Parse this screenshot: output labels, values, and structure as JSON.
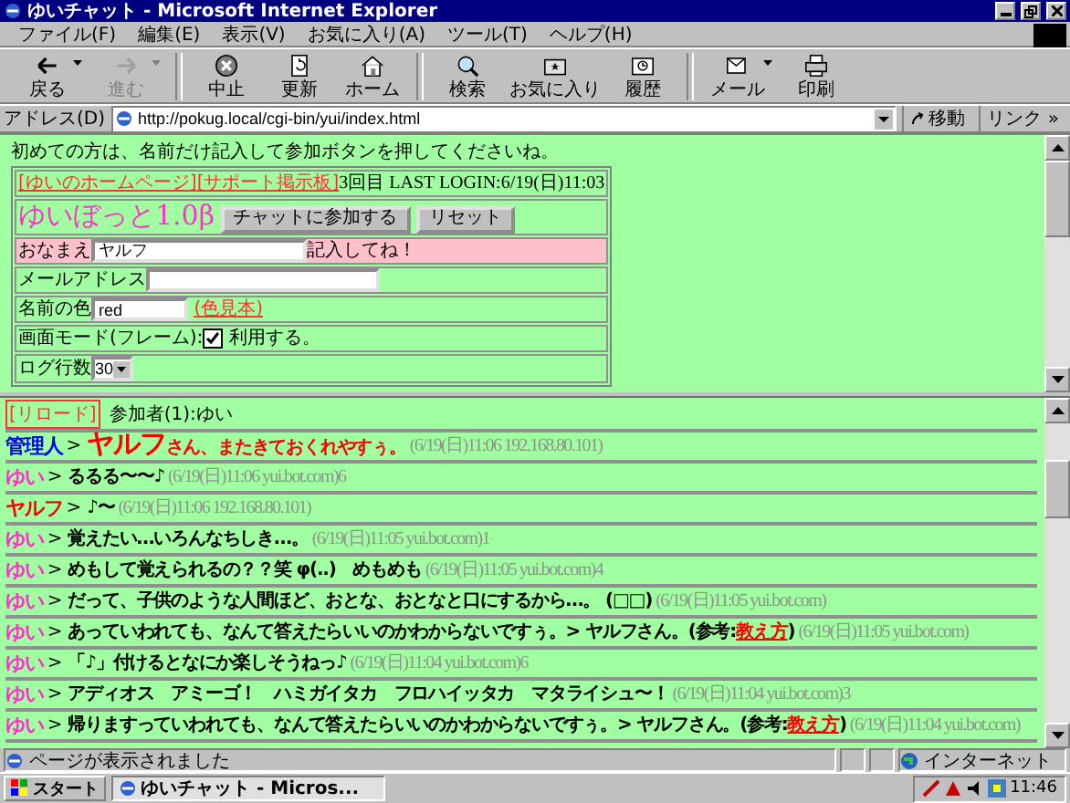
{
  "window": {
    "title": "ゆいチャット - Microsoft Internet Explorer"
  },
  "menu": [
    "ファイル(F)",
    "編集(E)",
    "表示(V)",
    "お気に入り(A)",
    "ツール(T)",
    "ヘルプ(H)"
  ],
  "toolbar": [
    {
      "label": "戻る",
      "kind": "back",
      "disabled": false,
      "dropdown": true
    },
    {
      "label": "進む",
      "kind": "forward",
      "disabled": true,
      "dropdown": true
    },
    {
      "label": "中止",
      "kind": "stop",
      "disabled": false,
      "dropdown": false
    },
    {
      "label": "更新",
      "kind": "refresh",
      "disabled": false,
      "dropdown": false
    },
    {
      "label": "ホーム",
      "kind": "home",
      "disabled": false,
      "dropdown": false
    },
    {
      "label": "検索",
      "kind": "search",
      "disabled": false,
      "dropdown": false
    },
    {
      "label": "お気に入り",
      "kind": "favorites",
      "disabled": false,
      "dropdown": false
    },
    {
      "label": "履歴",
      "kind": "history",
      "disabled": false,
      "dropdown": false
    },
    {
      "label": "メール",
      "kind": "mail",
      "disabled": false,
      "dropdown": true
    },
    {
      "label": "印刷",
      "kind": "print",
      "disabled": false,
      "dropdown": false
    }
  ],
  "address": {
    "label": "アドレス(D)",
    "value": "http://pokug.local/cgi-bin/yui/index.html",
    "go": "移動",
    "links": "リンク »"
  },
  "login_frame": {
    "intro": "初めての方は、名前だけ記入して参加ボタンを押してくださいね。",
    "links": [
      "[ゆいのホームページ]",
      "[サポート掲示板]"
    ],
    "login_info": "3回目 LAST LOGIN:6/19(日)11:03",
    "logo": "ゆいぼっと1.0β",
    "buttons": [
      "チャットに参加する",
      "リセット"
    ],
    "name": {
      "label": "おなまえ",
      "value": "ヤルフ",
      "hint": "記入してね！"
    },
    "email": {
      "label": "メールアドレス"
    },
    "color": {
      "label": "名前の色",
      "value": "red",
      "link": "(色見本)"
    },
    "frame_mode": {
      "label": "画面モード(フレーム):",
      "checked": true,
      "option": "利用する。"
    },
    "log_lines": {
      "label": "ログ行数",
      "value": "30"
    }
  },
  "chat_frame": {
    "reload": "[リロード]",
    "participants": "参加者(1):ゆい",
    "messages": [
      {
        "speaker": "管理人",
        "kind": "admin",
        "arrow": ">",
        "parts": [
          {
            "kind": "emph",
            "text": "ヤルフ"
          },
          {
            "kind": "plain",
            "text": "さん、またきておくれやすぅ。"
          }
        ],
        "meta": "(6/19(日)11:06 192.168.80.101)"
      },
      {
        "speaker": "ゆい",
        "kind": "bot",
        "arrow": ">",
        "parts": [
          {
            "kind": "plain",
            "text": "るるる〜〜♪"
          }
        ],
        "meta": "(6/19(日)11:06 yui.bot.com)6"
      },
      {
        "speaker": "ヤルフ",
        "kind": "user",
        "arrow": ">",
        "parts": [
          {
            "kind": "plain",
            "text": "♪〜"
          }
        ],
        "meta": "(6/19(日)11:06 192.168.80.101)"
      },
      {
        "speaker": "ゆい",
        "kind": "bot",
        "arrow": ">",
        "parts": [
          {
            "kind": "plain",
            "text": "覚えたい…いろんなちしき…。"
          }
        ],
        "meta": "(6/19(日)11:05 yui.bot.com)1"
      },
      {
        "speaker": "ゆい",
        "kind": "bot",
        "arrow": ">",
        "parts": [
          {
            "kind": "plain",
            "text": "めもして覚えられるの？？笑 φ(..)　めもめも"
          }
        ],
        "meta": "(6/19(日)11:05 yui.bot.com)4"
      },
      {
        "speaker": "ゆい",
        "kind": "bot",
        "arrow": ">",
        "parts": [
          {
            "kind": "plain",
            "text": "だって、子供のような人間ほど、おとな、おとなと口にするから…。 (□□)"
          }
        ],
        "meta": "(6/19(日)11:05 yui.bot.com)"
      },
      {
        "speaker": "ゆい",
        "kind": "bot",
        "arrow": ">",
        "parts": [
          {
            "kind": "plain",
            "text": "あっていわれても、なんて答えたらいいのかわからないですぅ。> ヤルフさん。(参考:"
          },
          {
            "kind": "link",
            "text": "教え方"
          },
          {
            "kind": "plain",
            "text": ")"
          }
        ],
        "meta": "(6/19(日)11:05 yui.bot.com)"
      },
      {
        "speaker": "ゆい",
        "kind": "bot",
        "arrow": ">",
        "parts": [
          {
            "kind": "plain",
            "text": "「♪」付けるとなにか楽しそうねっ♪"
          }
        ],
        "meta": "(6/19(日)11:04 yui.bot.com)6"
      },
      {
        "speaker": "ゆい",
        "kind": "bot",
        "arrow": ">",
        "parts": [
          {
            "kind": "plain",
            "text": "アディオス　アミーゴ！　ハミガイタカ　フロハイッタカ　マタライシュ〜！"
          }
        ],
        "meta": "(6/19(日)11:04 yui.bot.com)3"
      },
      {
        "speaker": "ゆい",
        "kind": "bot",
        "arrow": ">",
        "parts": [
          {
            "kind": "plain",
            "text": "帰りますっていわれても、なんて答えたらいいのかわからないですぅ。> ヤルフさん。(参考:"
          },
          {
            "kind": "link",
            "text": "教え方"
          },
          {
            "kind": "plain",
            "text": ")"
          }
        ],
        "meta": "(6/19(日)11:04 yui.bot.com)"
      }
    ]
  },
  "status_bar": {
    "text": "ページが表示されました",
    "zone": "インターネット"
  },
  "taskbar": {
    "start": "スタート",
    "task": "ゆいチャット - Micros...",
    "clock": "11:46"
  }
}
